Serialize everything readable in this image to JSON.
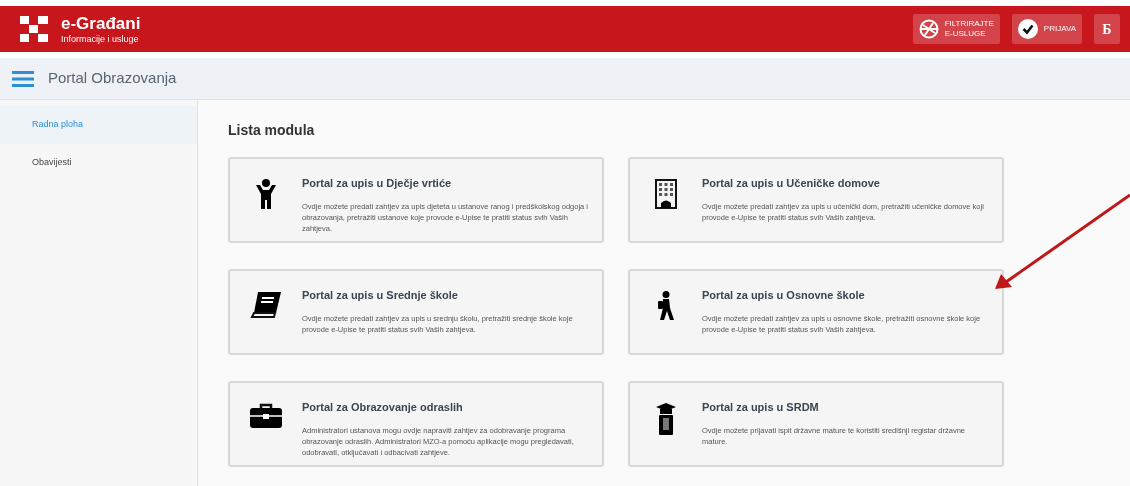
{
  "header": {
    "title": "e-Građani",
    "subtitle": "Informacije i usluge",
    "buttons": [
      {
        "kind": "filter",
        "label": "FILTRIRAJTE\nE-USLUGE"
      },
      {
        "kind": "login",
        "label": "PRIJAVA"
      },
      {
        "kind": "lang",
        "label": "Б"
      }
    ]
  },
  "nav": {
    "title": "Portal Obrazovanja"
  },
  "sidebar": {
    "items": [
      {
        "label": "Radna ploha",
        "selected": true
      },
      {
        "label": "Obavijesti",
        "selected": false
      }
    ]
  },
  "content": {
    "heading": "Lista modula",
    "modules": [
      {
        "kind": "child",
        "title": "Portal za upis u Dječje vrtiće",
        "text": "Ovdje možete predati zahtjev za upis djeteta u ustanove ranog i predškolskog odgoja i obrazovanja, pretražiti ustanove koje provode e-Upise te pratiti status svih Vaših zahtjeva."
      },
      {
        "kind": "building",
        "title": "Portal za upis u Učeničke domove",
        "text": "Ovdje možete predati zahtjev za upis u učenički dom, pretražiti učeničke domove koji provode e-Upise te pratiti status svih Vaših zahtjeva."
      },
      {
        "kind": "book",
        "title": "Portal za upis u Srednje škole",
        "text": "Ovdje možete predati zahtjev za upis u srednju školu, pretražiti srednje škole koje provode e-Upise te pratiti status svih Vaših zahtjeva."
      },
      {
        "kind": "walker",
        "title": "Portal za upis u Osnovne škole",
        "text": "Ovdje možete predati zahtjev za upis u osnovne škole, pretražiti osnovne škole koje provode e-Upise te pratiti status svih Vaših zahtjeva."
      },
      {
        "kind": "briefcase",
        "title": "Portal za Obrazovanje odraslih",
        "text": "Administratori ustanova mogu ovdje napraviti zahtjev za odobravanje programa obrazovanje odraslih. Administratori MZO-a pomoću aplikacije mogu pregledavati, odobravati, otključavati i odbacivati zahtjeve."
      },
      {
        "kind": "graduate",
        "title": "Portal za upis u SRDM",
        "text": "Ovdje možete prijavati ispit državne mature te koristiti središnji registar državne mature."
      }
    ]
  }
}
